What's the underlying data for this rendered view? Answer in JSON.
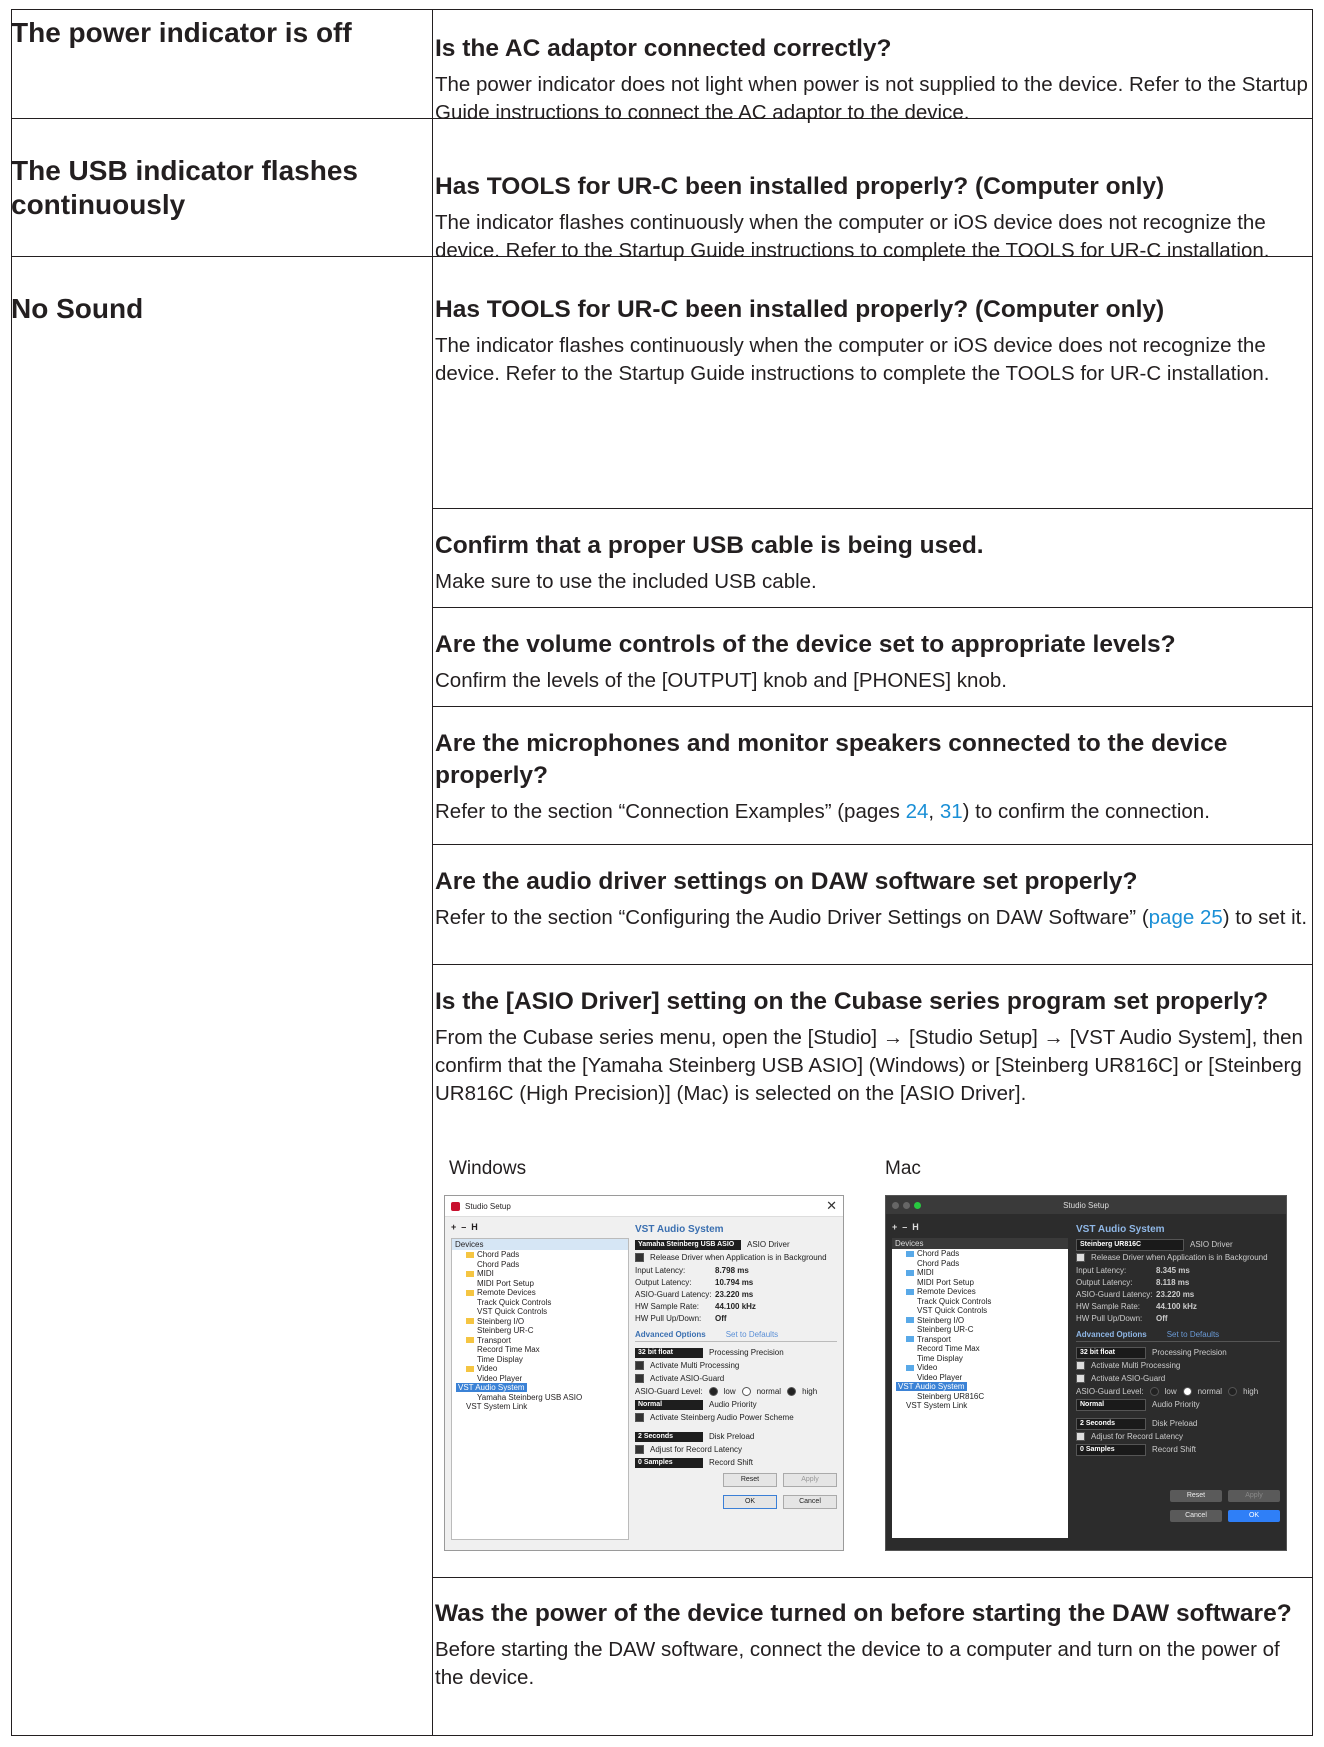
{
  "rows": [
    {
      "problem": "The power indicator is off",
      "question": "Is the AC adaptor connected correctly?",
      "answer": "The power indicator does not light when power is not supplied to the device. Refer to the Startup Guide instructions to connect the AC adaptor to the device."
    },
    {
      "problem": "The USB indicator flashes continuously",
      "question": "Has TOOLS for UR-C been installed properly? (Computer only)",
      "answer": "The indicator flashes continuously when the computer or iOS device does not recognize the device. Refer to the Startup Guide instructions to complete the TOOLS for UR-C installation."
    },
    {
      "problem": "No Sound",
      "items": [
        {
          "question": "Has TOOLS for UR-C been installed properly? (Computer only)",
          "answer": "The indicator flashes continuously when the computer or iOS device does not recognize the device. Refer to the Startup Guide instructions to complete the TOOLS for UR-C installation."
        },
        {
          "question": "Confirm that a proper USB cable is being used.",
          "answer": "Make sure to use the included USB cable."
        },
        {
          "question": "Are the volume controls of the device set to appropriate levels?",
          "answer": "Confirm the levels of the [OUTPUT] knob and [PHONES] knob."
        },
        {
          "question": "Are the microphones and monitor speakers connected to the device properly?",
          "answer_pre": "Refer to the section “Connection Examples” (pages ",
          "link1": "24",
          "sep": ", ",
          "link2": "31",
          "answer_post": ") to confirm the connection."
        },
        {
          "question": "Are the audio driver settings on DAW software set properly?",
          "answer_pre": "Refer to the section “Configuring the Audio Driver Settings on DAW Software” (",
          "link1": "page 25",
          "answer_post": ") to set it."
        },
        {
          "question": "Is the [ASIO Driver] setting on the Cubase series program set properly?",
          "answer": "From the Cubase series menu, open the [Studio] → [Studio Setup] → [VST Audio System], then confirm that the [Yamaha Steinberg USB ASIO] (Windows) or [Steinberg UR816C] or [Steinberg UR816C (High Precision)] (Mac) is selected on the [ASIO Driver]."
        },
        {
          "question": "Was the power of the device turned on before starting the DAW software?",
          "answer": "Before starting the DAW software, connect the device to a computer and turn on the power of the device."
        }
      ]
    }
  ],
  "screenshots": {
    "windows_label": "Windows",
    "mac_label": "Mac",
    "window_title": "Studio Setup",
    "toolbar": [
      "+",
      "–",
      "H"
    ],
    "tree_header": "Devices",
    "windows_tree": [
      "Chord Pads",
      "Chord Pads",
      "MIDI",
      "MIDI Port Setup",
      "Remote Devices",
      "Track Quick Controls",
      "VST Quick Controls",
      "Steinberg I/O",
      "Steinberg UR-C",
      "Transport",
      "Record Time Max",
      "Time Display",
      "Video",
      "Video Player",
      "VST Audio System",
      "Yamaha Steinberg USB ASIO",
      "VST System Link"
    ],
    "mac_tree": [
      "Chord Pads",
      "Chord Pads",
      "MIDI",
      "MIDI Port Setup",
      "Remote Devices",
      "Track Quick Controls",
      "VST Quick Controls",
      "Steinberg I/O",
      "Steinberg UR-C",
      "Transport",
      "Record Time Max",
      "Time Display",
      "Video",
      "Video Player",
      "VST Audio System",
      "Steinberg UR816C",
      "VST System Link"
    ],
    "panel_title": "VST Audio System",
    "asio_driver_label": "ASIO Driver",
    "windows_driver": "Yamaha Steinberg USB ASIO",
    "mac_driver": "Steinberg UR816C",
    "release_driver": "Release Driver when Application is in Background",
    "windows_stats": [
      {
        "k": "Input Latency:",
        "v": "8.798 ms"
      },
      {
        "k": "Output Latency:",
        "v": "10.794 ms"
      },
      {
        "k": "ASIO-Guard Latency:",
        "v": "23.220 ms"
      },
      {
        "k": "HW Sample Rate:",
        "v": "44.100 kHz"
      },
      {
        "k": "HW Pull Up/Down:",
        "v": "Off"
      }
    ],
    "mac_stats": [
      {
        "k": "Input Latency:",
        "v": "8.345 ms"
      },
      {
        "k": "Output Latency:",
        "v": "8.118 ms"
      },
      {
        "k": "ASIO-Guard Latency:",
        "v": "23.220 ms"
      },
      {
        "k": "HW Sample Rate:",
        "v": "44.100 kHz"
      },
      {
        "k": "HW Pull Up/Down:",
        "v": "Off"
      }
    ],
    "advanced_options": "Advanced Options",
    "set_to_defaults": "Set to Defaults",
    "precision_value": "32 bit float",
    "precision_label": "Processing Precision",
    "multi_processing": "Activate Multi Processing",
    "asio_guard": "Activate ASIO-Guard",
    "asio_guard_level": "ASIO-Guard Level:",
    "levels": [
      "low",
      "normal",
      "high"
    ],
    "priority_value": "Normal",
    "priority_label": "Audio Priority",
    "power_scheme": "Activate Steinberg Audio Power Scheme",
    "preload_value": "2 Seconds",
    "preload_label": "Disk Preload",
    "adjust_latency": "Adjust for Record Latency",
    "shift_value": "0 Samples",
    "shift_label": "Record Shift",
    "reset": "Reset",
    "apply": "Apply",
    "ok": "OK",
    "cancel": "Cancel"
  }
}
